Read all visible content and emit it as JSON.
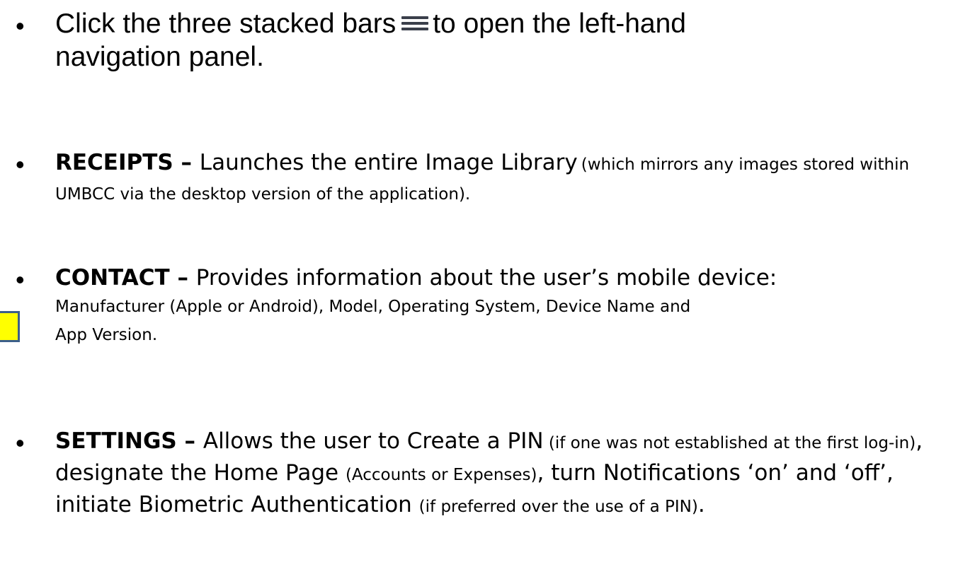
{
  "bullet_glyph": "•",
  "items": [
    {
      "before": "Click the three stacked bars",
      "icon": "hamburger-menu-icon",
      "after": "to open the left-hand navigation panel."
    },
    {
      "title": "RECEIPTS",
      "dash": " – ",
      "lead": "Launches the entire Image Library",
      "detail": "(which mirrors any images stored within UMBCC via the desktop version of the application)."
    },
    {
      "title": "CONTACT",
      "dash": " – ",
      "lead": "Provides information about the user’s mobile device:",
      "detail": "Manufacturer (Apple or Android), Model, Operating System, Device Name and App Version."
    },
    {
      "title": "SETTINGS",
      "dash": " – ",
      "seg1": "Allows the user to Create a PIN",
      "seg2": " (if one was not established at the first log-in)",
      "seg3": ", designate the Home Page ",
      "seg4": "(Accounts or Expenses)",
      "seg5": ", turn Notifications ‘on’ and ‘off’, initiate Biometric Authentication ",
      "seg6": "(if preferred over the use of a PIN)",
      "seg7": "."
    }
  ],
  "colors": {
    "marker_fill": "#ffff00",
    "marker_border": "#3c5f8a",
    "icon_bars": "#3a3f4a"
  }
}
